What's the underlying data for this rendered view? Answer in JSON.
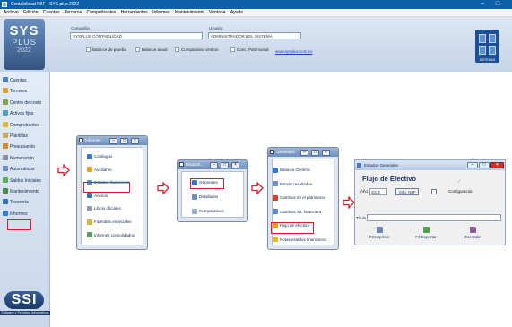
{
  "window": {
    "title": "Contabilidad NIIF - SYS plus 2022",
    "minimize": "−",
    "maximize": "□"
  },
  "menu": [
    "Archivo",
    "Edición",
    "Cuentas",
    "Terceros",
    "Comprobantes",
    "Herramientas",
    "Informes",
    "Mantenimiento",
    "Ventana",
    "Ayuda"
  ],
  "header": {
    "logo": {
      "line1": "SYS",
      "line2": "PLUS",
      "line3": "2022"
    },
    "company_label": "Compañía",
    "company_value": "SYSPLUS CONTABILIDAD",
    "user_label": "Usuario",
    "user_value": "ADMINISTRADOR DEL SISTEMA",
    "quick": [
      "Balance de prueba",
      "Balance anual",
      "Comparativo centros",
      "Conc. Patrimonial"
    ],
    "link": "www.sysplus.com.co",
    "right_logo_text": "SISTEMAS"
  },
  "sidebar": {
    "items": [
      {
        "label": "Cuentas",
        "icon": "accounts-icon",
        "color": "#4a7fc1"
      },
      {
        "label": "Terceros",
        "icon": "people-icon",
        "color": "#e39f2c"
      },
      {
        "label": "Centro de costo",
        "icon": "cost-center-icon",
        "color": "#7aa64a"
      },
      {
        "label": "Activos fijos",
        "icon": "fixed-assets-icon",
        "color": "#4aa0c8"
      },
      {
        "label": "Comprobantes",
        "icon": "vouchers-icon",
        "color": "#d8b73a"
      },
      {
        "label": "Plantillas",
        "icon": "templates-icon",
        "color": "#c8a85a"
      },
      {
        "label": "Presupuesto",
        "icon": "budget-icon",
        "color": "#d08a2e"
      },
      {
        "label": "Numeración",
        "icon": "numbering-icon",
        "color": "#8a8aa0"
      },
      {
        "label": "Automáticos",
        "icon": "automatic-icon",
        "color": "#6a8fd0"
      },
      {
        "label": "Saldos Iniciales",
        "icon": "initial-balances-icon",
        "color": "#5aa85a"
      },
      {
        "label": "Mantenimiento",
        "icon": "maintenance-icon",
        "color": "#4a8a3a"
      },
      {
        "label": "Tesorería",
        "icon": "treasury-icon",
        "color": "#2e6fb8"
      },
      {
        "label": "Informes",
        "icon": "reports-icon",
        "color": "#3a7ad0"
      }
    ],
    "company_logo": "SSI",
    "company_sub": "Software y Servicios Informáticos"
  },
  "win_informes": {
    "title": "Informes",
    "items": [
      {
        "label": "Catálogos",
        "color": "#2f77d0"
      },
      {
        "label": "Auxiliares",
        "color": "#e5a12a"
      },
      {
        "label": "Estados financieros",
        "color": "#6a8fc8"
      },
      {
        "label": "Anexos",
        "color": "#2e6fb8"
      },
      {
        "label": "Libros oficiales",
        "color": "#8a9bb8"
      },
      {
        "label": "Formatos especiales",
        "color": "#e3b23a"
      },
      {
        "label": "Informes consolidados",
        "color": "#5aa05a"
      }
    ]
  },
  "win_estados": {
    "title": "Estados...",
    "items": [
      {
        "label": "Generales",
        "color": "#2f77d0"
      },
      {
        "label": "Detallados",
        "color": "#6a8fc8"
      },
      {
        "label": "Comparativos",
        "color": "#9aaccc"
      }
    ]
  },
  "win_generales": {
    "title": "Generales",
    "items": [
      {
        "label": "Balance General",
        "color": "#2f77d0"
      },
      {
        "label": "Estado resultados",
        "color": "#6a8fc8"
      },
      {
        "label": "Cambios en el patrimonio",
        "color": "#d0442a"
      },
      {
        "label": "Cambios Sit. financiera",
        "color": "#5a88d0"
      },
      {
        "label": "Flujo de efectivo",
        "color": "#e3a02a"
      },
      {
        "label": "Notas estados financieros",
        "color": "#e3b23a"
      }
    ]
  },
  "dialog": {
    "window_title": "Estados Generales",
    "heading": "Flujo de Efectivo",
    "year_label": "Año",
    "year_value": "2022",
    "niif_button": "Info. NIIF",
    "config_label": "Configuración",
    "titulo_label": "Título",
    "buttons": [
      {
        "label": "F2:Imprimir",
        "color": "#6a84b8"
      },
      {
        "label": "F4:Exportar",
        "color": "#4aa04a"
      },
      {
        "label": "Esc:Salir",
        "color": "#8a5a9a"
      }
    ],
    "close": "✕"
  },
  "colors": {
    "highlight": "#e01a2c",
    "arrow": "#e01a2c",
    "titlebar": "#0c5fa8"
  }
}
